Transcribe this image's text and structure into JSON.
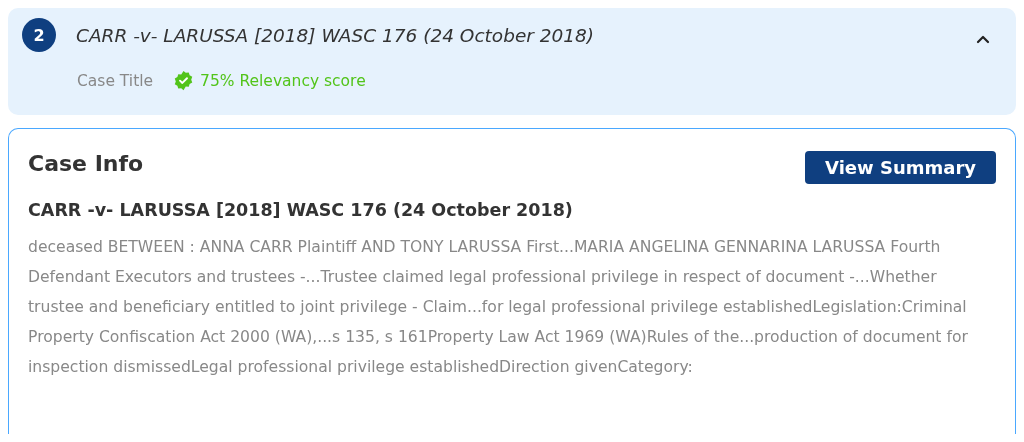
{
  "result": {
    "number": "2",
    "title": "CARR -v- LARUSSA [2018] WASC 176 (24 October 2018)",
    "expanded": true,
    "match_type": "Case Title",
    "relevancy": "75% Relevancy score"
  },
  "case_info": {
    "heading": "Case Info",
    "button": "View Summary",
    "case_name": "CARR -v- LARUSSA [2018] WASC 176 (24 October 2018)",
    "excerpt": "deceased BETWEEN : ANNA CARR Plaintiff AND TONY LARUSSA First...MARIA ANGELINA GENNARINA LARUSSA Fourth Defendant Executors and trustees -...Trustee claimed legal professional privilege in respect of document -...Whether trustee and beneficiary entitled to joint privilege - Claim...for legal professional privilege establishedLegislation:Criminal Property Confiscation Act 2000 (WA),...s 135, s 161Property Law Act 1969 (WA)Rules of the...production of document for inspection dismissedLegal professional privilege establishedDirection givenCategory:"
  }
}
